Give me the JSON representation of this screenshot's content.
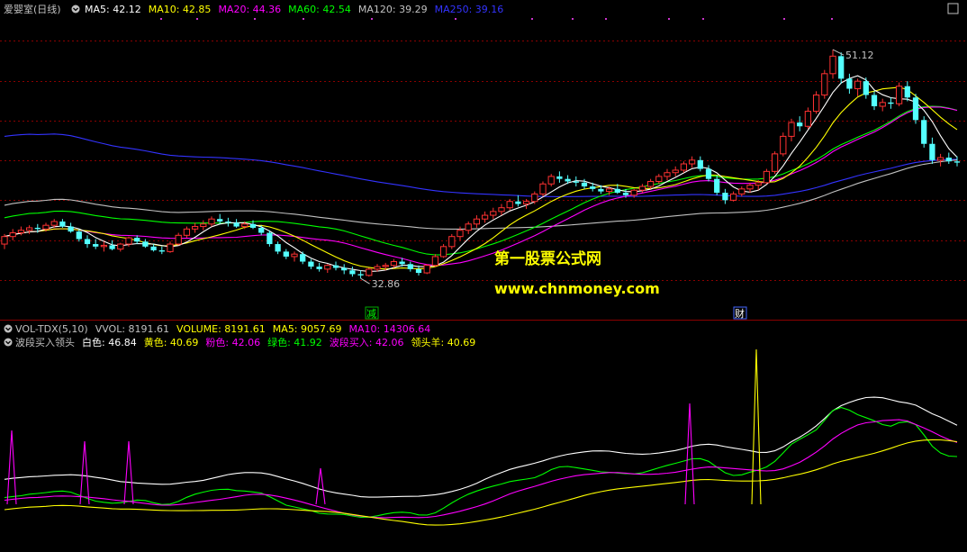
{
  "header": {
    "title": "爱婴室(日线)",
    "ma_items": [
      {
        "label": "MA5: 42.12",
        "color": "#ffffff"
      },
      {
        "label": "MA10: 42.85",
        "color": "#ffff00"
      },
      {
        "label": "MA20: 44.36",
        "color": "#ff00ff"
      },
      {
        "label": "MA60: 42.54",
        "color": "#00ff00"
      },
      {
        "label": "MA120: 39.29",
        "color": "#c0c0c0"
      },
      {
        "label": "MA250: 39.16",
        "color": "#3333ff"
      }
    ]
  },
  "annotations": {
    "high": "51.12",
    "low": "32.86",
    "marker_jian": "减",
    "marker_cai": "财"
  },
  "watermark": {
    "line1": "第一股票公式网",
    "line2": "www.chnmoney.com"
  },
  "panel_vol": {
    "items": [
      {
        "label": "VOL-TDX(5,10)",
        "color": "#c0c0c0"
      },
      {
        "label": "VVOL: 8191.61",
        "color": "#c0c0c0"
      },
      {
        "label": "VOLUME: 8191.61",
        "color": "#ffff00"
      },
      {
        "label": "MA5: 9057.69",
        "color": "#ffff00"
      },
      {
        "label": "MA10: 14306.64",
        "color": "#ff00ff"
      }
    ]
  },
  "panel_ind": {
    "items": [
      {
        "label": "波段买入领头",
        "color": "#c0c0c0"
      },
      {
        "label": "白色: 46.84",
        "color": "#ffffff"
      },
      {
        "label": "黄色: 40.69",
        "color": "#ffff00"
      },
      {
        "label": "粉色: 42.06",
        "color": "#ff00ff"
      },
      {
        "label": "绿色: 41.92",
        "color": "#00ff00"
      },
      {
        "label": "波段买入: 42.06",
        "color": "#ff00ff"
      },
      {
        "label": "领头羊: 40.69",
        "color": "#ffff00"
      }
    ]
  },
  "colors": {
    "up": "#ff3232",
    "down": "#54ffff",
    "ma5": "#ffffff",
    "ma10": "#ffff00",
    "ma20": "#ff00ff",
    "ma60": "#00ff00",
    "ma120": "#c0c0c0",
    "ma250": "#3333ff",
    "grid": "#8b0000"
  },
  "chart_data": {
    "type": "candlestick",
    "price_ylim": [
      30.5,
      53.5
    ],
    "high": 51.12,
    "low": 32.86,
    "candles": [
      [
        35.6,
        36.4,
        35.2,
        36.2
      ],
      [
        36.2,
        36.8,
        35.9,
        36.5
      ],
      [
        36.5,
        37.0,
        36.3,
        36.7
      ],
      [
        36.7,
        37.1,
        36.4,
        36.9
      ],
      [
        36.9,
        37.2,
        36.5,
        36.8
      ],
      [
        36.8,
        37.3,
        36.6,
        37.1
      ],
      [
        37.1,
        37.6,
        36.9,
        37.4
      ],
      [
        37.4,
        37.6,
        36.9,
        37.0
      ],
      [
        37.0,
        37.3,
        36.5,
        36.6
      ],
      [
        36.6,
        36.8,
        35.8,
        36.0
      ],
      [
        36.0,
        36.3,
        35.3,
        35.6
      ],
      [
        35.6,
        36.0,
        35.2,
        35.4
      ],
      [
        35.4,
        35.8,
        35.0,
        35.5
      ],
      [
        35.5,
        35.9,
        35.1,
        35.2
      ],
      [
        35.2,
        35.7,
        35.0,
        35.6
      ],
      [
        35.6,
        36.2,
        35.4,
        36.1
      ],
      [
        36.1,
        36.3,
        35.6,
        35.8
      ],
      [
        35.8,
        36.0,
        35.3,
        35.4
      ],
      [
        35.4,
        35.6,
        35.0,
        35.1
      ],
      [
        35.1,
        35.4,
        34.8,
        35.0
      ],
      [
        35.0,
        35.8,
        34.9,
        35.6
      ],
      [
        35.6,
        36.5,
        35.5,
        36.3
      ],
      [
        36.3,
        37.0,
        36.1,
        36.8
      ],
      [
        36.8,
        37.3,
        36.5,
        37.0
      ],
      [
        37.0,
        37.5,
        36.7,
        37.2
      ],
      [
        37.2,
        37.8,
        37.0,
        37.6
      ],
      [
        37.6,
        38.0,
        37.2,
        37.4
      ],
      [
        37.4,
        37.7,
        37.0,
        37.3
      ],
      [
        37.3,
        37.6,
        36.9,
        37.0
      ],
      [
        37.0,
        37.4,
        36.8,
        37.2
      ],
      [
        37.2,
        37.5,
        36.8,
        36.9
      ],
      [
        36.9,
        37.1,
        36.3,
        36.5
      ],
      [
        36.5,
        36.7,
        35.4,
        35.6
      ],
      [
        35.6,
        35.8,
        34.8,
        35.0
      ],
      [
        35.0,
        35.2,
        34.4,
        34.6
      ],
      [
        34.6,
        35.0,
        34.2,
        34.8
      ],
      [
        34.8,
        35.0,
        34.0,
        34.2
      ],
      [
        34.2,
        34.4,
        33.6,
        33.8
      ],
      [
        33.8,
        34.1,
        33.4,
        33.6
      ],
      [
        33.6,
        34.0,
        33.3,
        33.9
      ],
      [
        33.9,
        34.2,
        33.5,
        33.7
      ],
      [
        33.7,
        34.0,
        33.2,
        33.5
      ],
      [
        33.5,
        33.8,
        33.0,
        33.2
      ],
      [
        33.2,
        33.5,
        32.86,
        33.1
      ],
      [
        33.1,
        33.7,
        33.0,
        33.6
      ],
      [
        33.6,
        34.0,
        33.4,
        33.8
      ],
      [
        33.8,
        34.1,
        33.5,
        33.9
      ],
      [
        33.9,
        34.4,
        33.7,
        34.2
      ],
      [
        34.2,
        34.5,
        33.8,
        34.0
      ],
      [
        34.0,
        34.2,
        33.4,
        33.6
      ],
      [
        33.6,
        33.9,
        33.1,
        33.3
      ],
      [
        33.3,
        34.0,
        33.2,
        33.9
      ],
      [
        33.9,
        34.8,
        33.8,
        34.6
      ],
      [
        34.6,
        35.6,
        34.5,
        35.4
      ],
      [
        35.4,
        36.4,
        35.2,
        36.2
      ],
      [
        36.2,
        37.0,
        35.9,
        36.7
      ],
      [
        36.7,
        37.4,
        36.4,
        37.2
      ],
      [
        37.2,
        37.9,
        36.9,
        37.6
      ],
      [
        37.6,
        38.2,
        37.3,
        37.9
      ],
      [
        37.9,
        38.5,
        37.6,
        38.2
      ],
      [
        38.2,
        38.8,
        37.9,
        38.5
      ],
      [
        38.5,
        39.2,
        38.3,
        39.0
      ],
      [
        39.0,
        39.5,
        38.6,
        38.8
      ],
      [
        38.8,
        39.2,
        38.4,
        39.0
      ],
      [
        39.0,
        39.8,
        38.8,
        39.6
      ],
      [
        39.6,
        40.6,
        39.4,
        40.4
      ],
      [
        40.4,
        41.2,
        40.2,
        41.0
      ],
      [
        41.0,
        41.4,
        40.5,
        40.8
      ],
      [
        40.8,
        41.1,
        40.4,
        40.6
      ],
      [
        40.6,
        41.0,
        40.2,
        40.5
      ],
      [
        40.5,
        40.8,
        40.0,
        40.2
      ],
      [
        40.2,
        40.5,
        39.8,
        40.0
      ],
      [
        40.0,
        40.3,
        39.6,
        39.8
      ],
      [
        39.8,
        40.2,
        39.5,
        40.0
      ],
      [
        40.0,
        40.4,
        39.6,
        39.7
      ],
      [
        39.7,
        40.0,
        39.3,
        39.5
      ],
      [
        39.5,
        40.0,
        39.3,
        39.9
      ],
      [
        39.9,
        40.4,
        39.7,
        40.2
      ],
      [
        40.2,
        40.8,
        40.0,
        40.6
      ],
      [
        40.6,
        41.2,
        40.4,
        41.0
      ],
      [
        41.0,
        41.6,
        40.7,
        41.3
      ],
      [
        41.3,
        41.8,
        41.0,
        41.5
      ],
      [
        41.5,
        42.2,
        41.3,
        42.0
      ],
      [
        42.0,
        42.6,
        41.7,
        42.3
      ],
      [
        42.3,
        42.6,
        41.4,
        41.6
      ],
      [
        41.6,
        41.9,
        40.6,
        40.8
      ],
      [
        40.8,
        41.1,
        39.5,
        39.7
      ],
      [
        39.7,
        40.0,
        38.8,
        39.1
      ],
      [
        39.1,
        39.8,
        39.0,
        39.6
      ],
      [
        39.6,
        40.2,
        39.4,
        40.0
      ],
      [
        40.0,
        40.5,
        39.7,
        40.3
      ],
      [
        40.3,
        40.7,
        39.9,
        40.5
      ],
      [
        40.5,
        41.6,
        40.4,
        41.4
      ],
      [
        41.4,
        43.0,
        41.2,
        42.8
      ],
      [
        42.8,
        44.5,
        42.6,
        44.2
      ],
      [
        44.2,
        45.6,
        43.8,
        45.3
      ],
      [
        45.3,
        45.8,
        44.6,
        45.0
      ],
      [
        45.0,
        46.5,
        44.8,
        46.2
      ],
      [
        46.2,
        47.8,
        46.0,
        47.5
      ],
      [
        47.5,
        49.5,
        47.2,
        49.2
      ],
      [
        49.2,
        51.12,
        48.8,
        50.6
      ],
      [
        50.6,
        50.9,
        48.4,
        48.8
      ],
      [
        48.8,
        49.2,
        47.6,
        48.0
      ],
      [
        48.0,
        48.8,
        47.4,
        48.6
      ],
      [
        48.6,
        48.9,
        47.2,
        47.5
      ],
      [
        47.5,
        47.8,
        46.3,
        46.6
      ],
      [
        46.6,
        47.2,
        46.2,
        46.9
      ],
      [
        46.9,
        47.3,
        46.4,
        46.8
      ],
      [
        46.8,
        48.5,
        46.6,
        48.2
      ],
      [
        48.2,
        48.6,
        47.0,
        47.3
      ],
      [
        47.3,
        47.6,
        45.2,
        45.5
      ],
      [
        45.5,
        45.8,
        43.3,
        43.6
      ],
      [
        43.6,
        44.1,
        42.0,
        42.3
      ],
      [
        42.3,
        42.8,
        41.8,
        42.5
      ],
      [
        42.5,
        42.9,
        42.0,
        42.2
      ],
      [
        42.2,
        42.6,
        41.8,
        42.1
      ]
    ]
  }
}
